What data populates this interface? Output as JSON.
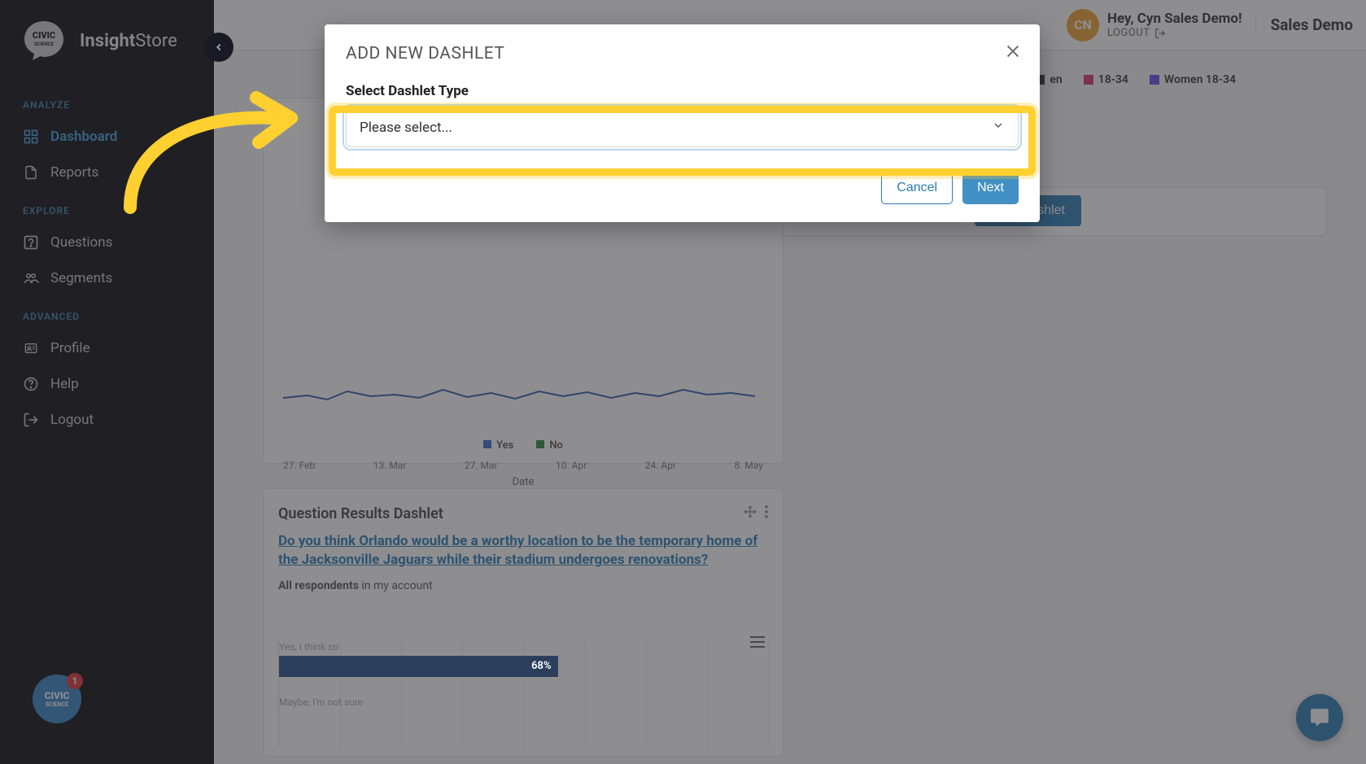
{
  "sidebar": {
    "app_name_bold": "Insight",
    "app_name_light": "Store",
    "logo_main": "CIVIC",
    "logo_sub": "SCIENCE",
    "sections": {
      "analyze": "ANALYZE",
      "explore": "EXPLORE",
      "advanced": "ADVANCED"
    },
    "items": {
      "dashboard": "Dashboard",
      "reports": "Reports",
      "questions": "Questions",
      "segments": "Segments",
      "profile": "Profile",
      "help": "Help",
      "logout": "Logout"
    },
    "badge_count": "1",
    "badge_top": "CIVIC",
    "badge_bot": "SCIENCE"
  },
  "header": {
    "avatar_initials": "CN",
    "greeting": "Hey, Cyn Sales Demo!",
    "logout_label": "LOGOUT",
    "org": "Sales Demo"
  },
  "legend_chips": {
    "en": "en",
    "r1834": "18-34",
    "women": "Women 18-34"
  },
  "new_dashlet_button": "New Dashlet",
  "line_card": {
    "ticks": [
      "27. Feb",
      "13. Mar",
      "27. Mar",
      "10. Apr",
      "24. Apr",
      "8. May"
    ],
    "axis_label": "Date",
    "legend_yes": "Yes",
    "legend_no": "No"
  },
  "results_card": {
    "title": "Question Results Dashlet",
    "question": "Do you think Orlando would be a worthy location to be the temporary home of the Jacksonville Jaguars while their stadium undergoes renovations?",
    "respondents_bold": "All respondents",
    "respondents_rest": " in my account",
    "bar1_label": "Yes, I think so",
    "bar1_value": "68%",
    "bar2_label": "Maybe, I'm not sure"
  },
  "modal": {
    "title": "ADD NEW DASHLET",
    "field_label": "Select Dashlet Type",
    "select_placeholder": "Please select...",
    "cancel": "Cancel",
    "next": "Next"
  },
  "chart_data": {
    "type": "bar",
    "categories": [
      "Yes, I think so",
      "Maybe, I'm not sure"
    ],
    "values": [
      68,
      null
    ],
    "xlabel": "",
    "ylabel": "",
    "title": "Question Results Dashlet"
  }
}
